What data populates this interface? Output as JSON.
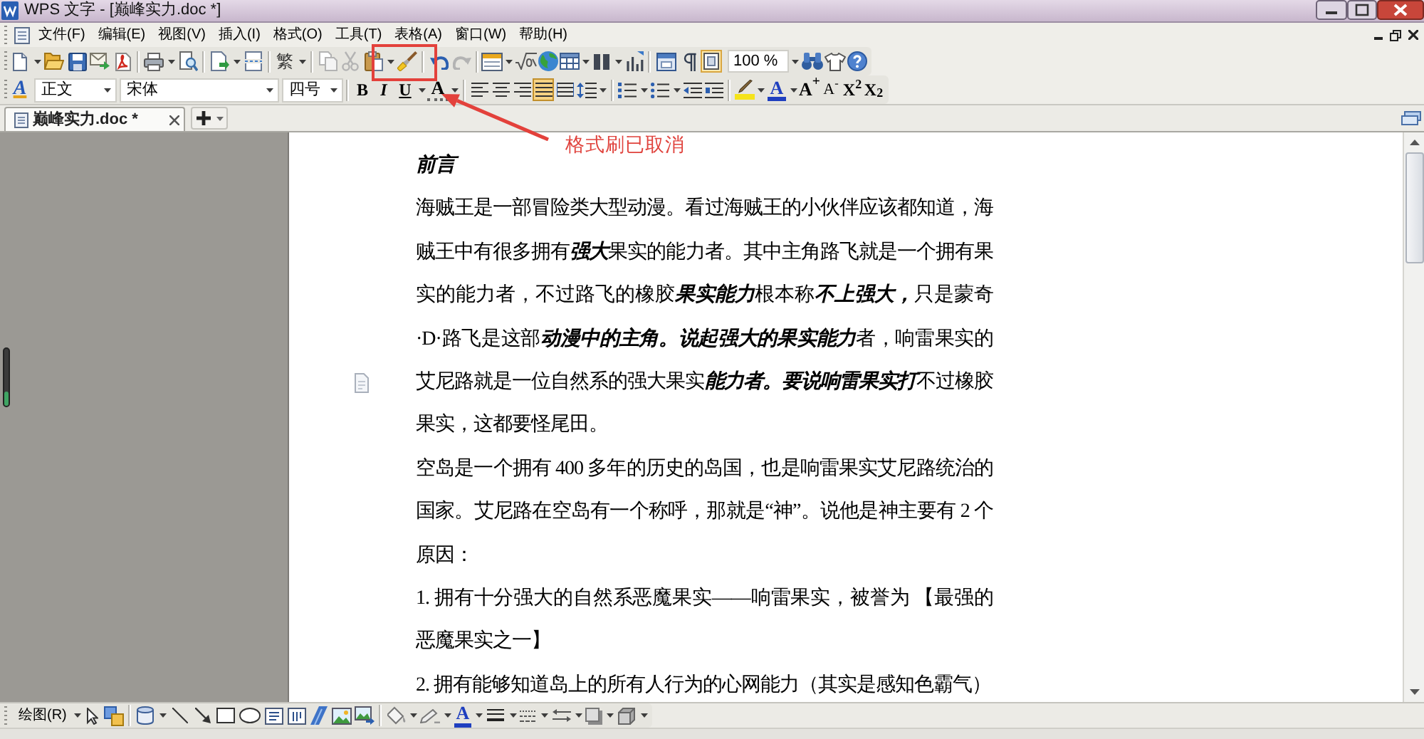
{
  "window": {
    "title": "WPS 文字 - [巅峰实力.doc *]"
  },
  "menu_bar": {
    "items": [
      "文件(F)",
      "编辑(E)",
      "视图(V)",
      "插入(I)",
      "格式(O)",
      "工具(T)",
      "表格(A)",
      "窗口(W)",
      "帮助(H)"
    ]
  },
  "standard_toolbar": {
    "traditional_chinese": "繁",
    "clipboard": [
      {
        "kind": "copy",
        "disabled": true
      },
      {
        "kind": "cut",
        "disabled": true
      },
      {
        "kind": "paste",
        "disabled": false
      }
    ],
    "history": [
      {
        "kind": "undo",
        "disabled": false
      },
      {
        "kind": "redo",
        "disabled": true
      }
    ],
    "page_view": {
      "on": true
    },
    "zoom": "100 %"
  },
  "formatting_toolbar": {
    "style_icon": "A",
    "style": "正文",
    "font": "宋体",
    "size": "四号",
    "bold": "B",
    "italic": "I",
    "underline": "U",
    "char_shading": "A",
    "alignment": [
      {
        "kind": "left",
        "selected": false
      },
      {
        "kind": "center",
        "selected": false
      },
      {
        "kind": "right",
        "selected": false
      },
      {
        "kind": "justify",
        "selected": true
      },
      {
        "kind": "distributed",
        "selected": false
      }
    ],
    "font_color": "A",
    "grow_font": "A$^{+}$",
    "shrink_font": "A$^{-}$",
    "superscript": "X$^{2}$",
    "subscript": "X$_{2}$"
  },
  "tabs": [
    {
      "label": "巅峰实力.doc *",
      "selected": true
    }
  ],
  "document": {
    "heading": "前言",
    "paragraphs": [
      "海贼王是一部冒险类大型动漫。看过海贼王的小伙伴应该都知道，海贼王中有很多拥有**强大**果实的能力者。其中主角路飞就是一个拥有果实的能力者，不过路飞的橡胶**果实能力**根本称**不上强大，**只是蒙奇·D·路飞是这部**动漫中的主角。说起强大的果实能力**者，响雷果实的艾尼路就是一位自然系的强大果实**能力者。要说响雷果实打**不过橡胶果实，这都要怪尾田。",
      "空岛是一个拥有 400 多年的历史的岛国，也是响雷果实艾尼路统治的国家。艾尼路在空岛有一个称呼，那就是“神”。说他是神主要有 2 个原因：",
      "1. 拥有十分强大的自然系恶魔果实——响雷果实，被誉为 【最强的恶魔果实之一】",
      "2. 拥有能够知道岛上的所有人行为的心网能力（其实是感知色霸气）"
    ]
  },
  "annotation": {
    "label": "格式刷已取消"
  },
  "drawing_toolbar": {
    "menu": "绘图(R)",
    "font_color": "A"
  }
}
